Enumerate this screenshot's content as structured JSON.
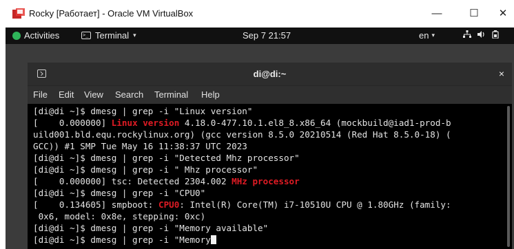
{
  "host": {
    "title": "Rocky [Работает] - Oracle VM VirtualBox",
    "minimize": "—",
    "maximize": "☐",
    "close": "✕"
  },
  "topbar": {
    "activities": "Activities",
    "app_menu": "Terminal",
    "app_menu_caret": "▾",
    "clock": "Sep 7  21:57",
    "lang": "en",
    "lang_caret": "▾",
    "icons": [
      "network-icon",
      "volume-icon",
      "battery-icon"
    ]
  },
  "terminal": {
    "title": "di@di:~",
    "close": "×",
    "menu": [
      "File",
      "Edit",
      "View",
      "Search",
      "Terminal",
      "Help"
    ],
    "lines": [
      [
        {
          "t": "[di@di ~]$ dmesg | grep -i \"Linux version\""
        }
      ],
      [
        {
          "t": "[    0.000000] "
        },
        {
          "t": "Linux version",
          "hl": true
        },
        {
          "t": " 4.18.0-477.10.1.el8_8.x86_64 (mockbuild@iad1-prod-b"
        }
      ],
      [
        {
          "t": "uild001.bld.equ.rockylinux.org) (gcc version 8.5.0 20210514 (Red Hat 8.5.0-18) ("
        }
      ],
      [
        {
          "t": "GCC)) #1 SMP Tue May 16 11:38:37 UTC 2023"
        }
      ],
      [
        {
          "t": "[di@di ~]$ dmesg | grep -i \"Detected Mhz processor\""
        }
      ],
      [
        {
          "t": "[di@di ~]$ dmesg | grep -i \" Mhz processor\""
        }
      ],
      [
        {
          "t": "[    0.000000] tsc: Detected 2304.002 "
        },
        {
          "t": "MHz processor",
          "hl": true
        }
      ],
      [
        {
          "t": "[di@di ~]$ dmesg | grep -i \"CPU0\""
        }
      ],
      [
        {
          "t": "[    0.134605] smpboot: "
        },
        {
          "t": "CPU0",
          "hl": true
        },
        {
          "t": ": Intel(R) Core(TM) i7-10510U CPU @ 1.80GHz (family:"
        }
      ],
      [
        {
          "t": " 0x6, model: 0x8e, stepping: 0xc)"
        }
      ],
      [
        {
          "t": "[di@di ~]$ dmesg | grep -i \"Memory available\""
        }
      ],
      [
        {
          "t": "[di@di ~]$ dmesg | grep -i \"Memory"
        },
        {
          "cursor": true
        }
      ]
    ]
  },
  "colors": {
    "highlight": "#e01b24",
    "terminal_bg": "#000000",
    "desktop_bg": "#3b3b3b"
  }
}
